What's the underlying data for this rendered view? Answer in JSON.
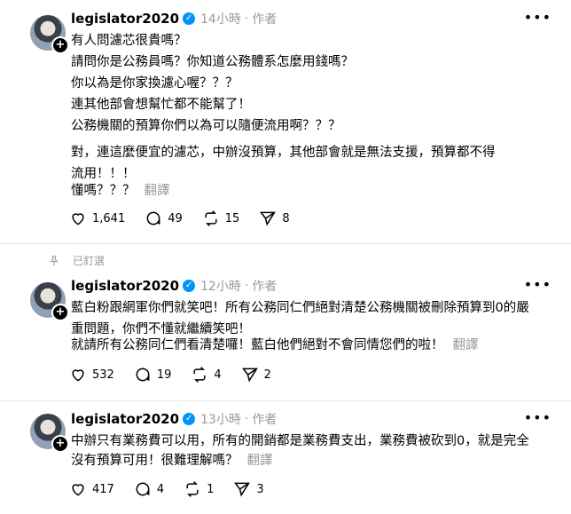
{
  "posts": [
    {
      "username": "legislator2020",
      "time": "14小時",
      "author_tag": "作者",
      "lines": [
        "有人問濾芯很貴嗎？",
        "請問你是公務員嗎？你知道公務體系怎麼用錢嗎？",
        "你以為是你家換濾心喔？？？",
        "連其他部會想幫忙都不能幫了！",
        "公務機關的預算你們以為可以隨便流用啊？？？",
        "對，連這麼便宜的濾芯，中辦沒預算，其他部會就是無法支援，預算都不得",
        "流用！！！",
        "懂嗎？？？"
      ],
      "translate": "翻譯",
      "likes": "1,641",
      "comments": "49",
      "reposts": "15",
      "shares": "8"
    },
    {
      "pinned_label": "已釘選",
      "username": "legislator2020",
      "time": "12小時",
      "author_tag": "作者",
      "lines": [
        "藍白粉跟網軍你們就笑吧！所有公務同仁們絕對清楚公務機關被刪除預算到0的嚴",
        "重問題，你們不懂就繼續笑吧！",
        "就請所有公務同仁們看清楚囉！藍白他們絕對不會同情您們的啦！"
      ],
      "translate": "翻譯",
      "likes": "532",
      "comments": "19",
      "reposts": "4",
      "shares": "2"
    },
    {
      "username": "legislator2020",
      "time": "13小時",
      "author_tag": "作者",
      "lines": [
        "中辦只有業務費可以用，所有的開銷都是業務費支出，業務費被砍到0，就是完全",
        "沒有預算可用！很難理解嗎？"
      ],
      "translate": "翻譯",
      "likes": "417",
      "comments": "4",
      "reposts": "1",
      "shares": "3"
    }
  ],
  "icons": {
    "more": "more-horizontal-icon",
    "like": "heart-icon",
    "comment": "speech-bubble-icon",
    "repost": "repost-icon",
    "share": "send-icon",
    "pin": "pin-icon",
    "verified": "verified-badge-icon"
  },
  "colors": {
    "verified": "#0095f6",
    "muted": "#999999",
    "divider": "#e5e5e5"
  }
}
